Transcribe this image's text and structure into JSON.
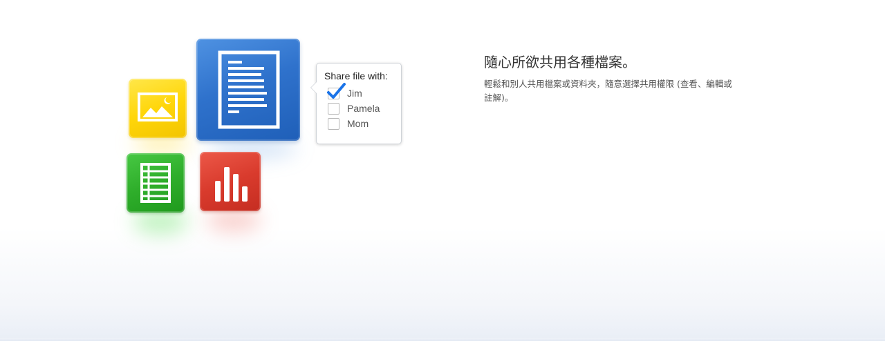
{
  "feature": {
    "headline": "隨心所欲共用各種檔案。",
    "description": "輕鬆和別人共用檔案或資料夾，隨意選擇共用權限 (查看、編輯或註解)。"
  },
  "illustration": {
    "cubes": [
      {
        "name": "document",
        "color": "#2f72cc",
        "icon": "document-icon"
      },
      {
        "name": "image",
        "color": "#ffd60a",
        "icon": "image-icon"
      },
      {
        "name": "spreadsheet",
        "color": "#2fae2b",
        "icon": "spreadsheet-icon"
      },
      {
        "name": "chart",
        "color": "#d93b2d",
        "icon": "bar-chart-icon"
      }
    ]
  },
  "share_popup": {
    "title": "Share file with:",
    "options": [
      {
        "label": "Jim",
        "checked": true
      },
      {
        "label": "Pamela",
        "checked": false
      },
      {
        "label": "Mom",
        "checked": false
      }
    ],
    "check_color": "#1a73e8"
  }
}
